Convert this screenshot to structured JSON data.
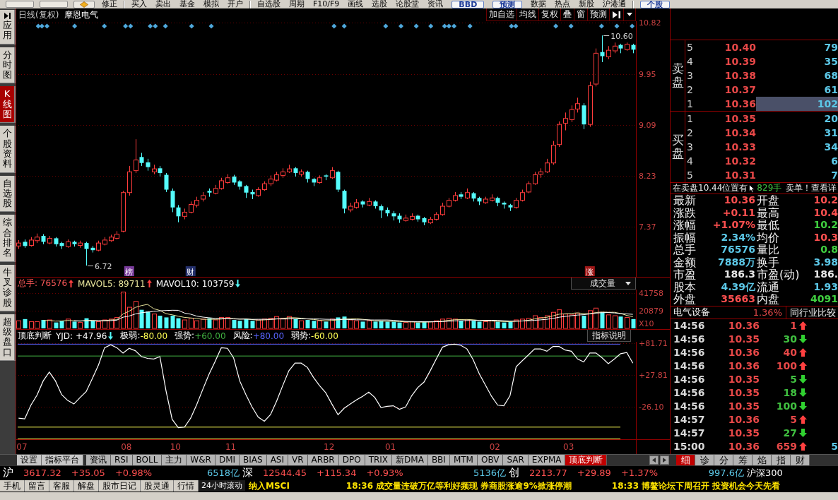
{
  "toolbar": [
    {
      "kind": "blank"
    },
    {
      "kind": "blank"
    },
    {
      "kind": "icon"
    },
    {
      "kind": "text",
      "label": "修正"
    },
    {
      "kind": "separator"
    },
    {
      "kind": "text",
      "label": "买入"
    },
    {
      "kind": "text",
      "label": "卖出"
    },
    {
      "kind": "text",
      "label": "基金"
    },
    {
      "kind": "text",
      "label": "模拟"
    },
    {
      "kind": "text",
      "label": "开户"
    },
    {
      "kind": "separator"
    },
    {
      "kind": "text",
      "label": "自选股"
    },
    {
      "kind": "text",
      "label": "周期"
    },
    {
      "kind": "text",
      "label": "F10/F9"
    },
    {
      "kind": "text",
      "label": "画线"
    },
    {
      "kind": "text",
      "label": "选股"
    },
    {
      "kind": "text",
      "label": "论股堂"
    },
    {
      "kind": "text",
      "label": "资讯"
    },
    {
      "kind": "button",
      "label": "BBD"
    },
    {
      "kind": "button",
      "label": "预测"
    },
    {
      "kind": "text",
      "label": "数据"
    },
    {
      "kind": "text",
      "label": "热点"
    },
    {
      "kind": "text",
      "label": "新股"
    },
    {
      "kind": "text",
      "label": "沪港通"
    },
    {
      "kind": "separator"
    },
    {
      "kind": "button",
      "label": "个股"
    }
  ],
  "sidebar": [
    {
      "label": "应用",
      "kind": "app",
      "selected": false
    },
    {
      "label": "分时图",
      "kind": "tab",
      "selected": false
    },
    {
      "label": "K线图",
      "kind": "tab",
      "selected": true
    },
    {
      "label": "个股资料",
      "kind": "tab",
      "selected": false
    },
    {
      "label": "自选股",
      "kind": "tab",
      "selected": false
    },
    {
      "label": "综合排名",
      "kind": "tab",
      "selected": false
    },
    {
      "label": "牛叉诊股",
      "kind": "tab",
      "selected": false
    },
    {
      "label": "超级盘口",
      "kind": "tab",
      "selected": false
    }
  ],
  "chart": {
    "period": "日线(复权)",
    "stock": "摩恩电气",
    "buttons": [
      "加自选",
      "均线",
      "复权",
      "叠",
      "窗",
      "预测"
    ],
    "price": {
      "chart_data": {
        "type": "candlestick",
        "ohlc": [
          [
            7.05,
            7.15,
            7.0,
            7.1
          ],
          [
            7.12,
            7.16,
            7.02,
            7.05
          ],
          [
            7.06,
            7.2,
            7.04,
            7.15
          ],
          [
            7.14,
            7.26,
            7.1,
            7.2
          ],
          [
            7.22,
            7.25,
            7.08,
            7.12
          ],
          [
            7.1,
            7.22,
            7.08,
            7.18
          ],
          [
            7.18,
            7.2,
            7.04,
            7.08
          ],
          [
            7.1,
            7.12,
            7.0,
            7.05
          ],
          [
            7.04,
            7.16,
            7.02,
            7.12
          ],
          [
            7.12,
            7.14,
            7.04,
            7.08
          ],
          [
            7.06,
            7.14,
            7.02,
            7.1
          ],
          [
            7.1,
            7.12,
            6.72,
            7.0
          ],
          [
            7.02,
            7.05,
            6.94,
            6.98
          ],
          [
            6.98,
            7.14,
            6.96,
            7.1
          ],
          [
            7.08,
            7.2,
            7.06,
            7.15
          ],
          [
            7.14,
            7.24,
            7.12,
            7.2
          ],
          [
            7.18,
            7.3,
            7.16,
            7.25
          ],
          [
            7.3,
            7.98,
            7.28,
            7.95
          ],
          [
            7.95,
            8.4,
            7.9,
            8.3
          ],
          [
            8.32,
            8.85,
            8.28,
            8.5
          ],
          [
            8.55,
            8.62,
            8.4,
            8.45
          ],
          [
            8.46,
            8.52,
            8.32,
            8.38
          ],
          [
            8.3,
            8.42,
            8.26,
            8.35
          ],
          [
            8.36,
            8.4,
            8.22,
            8.28
          ],
          [
            8.25,
            8.28,
            7.96,
            8.0
          ],
          [
            7.98,
            8.02,
            7.62,
            7.7
          ],
          [
            7.7,
            7.74,
            7.45,
            7.55
          ],
          [
            7.55,
            7.68,
            7.5,
            7.62
          ],
          [
            7.62,
            7.8,
            7.6,
            7.75
          ],
          [
            7.74,
            7.88,
            7.7,
            7.82
          ],
          [
            7.84,
            7.96,
            7.8,
            7.9
          ],
          [
            7.98,
            8.02,
            7.88,
            7.95
          ],
          [
            7.94,
            8.08,
            7.92,
            8.02
          ],
          [
            8.02,
            8.2,
            8.0,
            8.15
          ],
          [
            8.12,
            8.26,
            8.1,
            8.2
          ],
          [
            8.22,
            8.25,
            8.08,
            8.12
          ],
          [
            8.14,
            8.16,
            8.0,
            8.05
          ],
          [
            8.06,
            8.08,
            7.86,
            7.95
          ],
          [
            7.96,
            8.0,
            7.84,
            7.92
          ],
          [
            7.9,
            8.04,
            7.88,
            8.0
          ],
          [
            8.0,
            8.14,
            7.98,
            8.1
          ],
          [
            8.1,
            8.24,
            8.06,
            8.18
          ],
          [
            8.16,
            8.3,
            8.14,
            8.25
          ],
          [
            8.24,
            8.36,
            8.2,
            8.3
          ],
          [
            8.3,
            8.42,
            8.28,
            8.35
          ],
          [
            8.36,
            8.38,
            8.22,
            8.28
          ],
          [
            8.26,
            8.34,
            8.22,
            8.3
          ],
          [
            8.3,
            8.32,
            8.12,
            8.18
          ],
          [
            8.18,
            8.2,
            8.06,
            8.12
          ],
          [
            8.12,
            8.24,
            8.1,
            8.2
          ],
          [
            8.24,
            8.26,
            8.16,
            8.22
          ],
          [
            8.2,
            8.38,
            8.18,
            8.32
          ],
          [
            8.3,
            8.32,
            7.96,
            8.0
          ],
          [
            7.98,
            8.0,
            7.6,
            7.68
          ],
          [
            7.66,
            7.78,
            7.62,
            7.72
          ],
          [
            7.7,
            7.84,
            7.68,
            7.78
          ],
          [
            7.8,
            7.82,
            7.7,
            7.75
          ],
          [
            7.74,
            7.86,
            7.72,
            7.8
          ],
          [
            7.8,
            7.82,
            7.68,
            7.72
          ],
          [
            7.72,
            7.75,
            7.52,
            7.65
          ],
          [
            7.66,
            7.7,
            7.55,
            7.6
          ],
          [
            7.6,
            7.64,
            7.48,
            7.55
          ],
          [
            7.56,
            7.6,
            7.44,
            7.5
          ],
          [
            7.48,
            7.58,
            7.46,
            7.52
          ],
          [
            7.5,
            7.6,
            7.48,
            7.55
          ],
          [
            7.56,
            7.58,
            7.46,
            7.5
          ],
          [
            7.52,
            7.54,
            7.4,
            7.45
          ],
          [
            7.44,
            7.54,
            7.42,
            7.5
          ],
          [
            7.5,
            7.62,
            7.48,
            7.58
          ],
          [
            7.58,
            7.78,
            7.56,
            7.72
          ],
          [
            7.72,
            7.86,
            7.7,
            7.82
          ],
          [
            7.82,
            7.96,
            7.8,
            7.9
          ],
          [
            7.92,
            7.96,
            7.84,
            7.88
          ],
          [
            7.86,
            8.02,
            7.84,
            7.95
          ],
          [
            7.94,
            7.96,
            7.8,
            7.85
          ],
          [
            7.86,
            7.88,
            7.74,
            7.8
          ],
          [
            7.78,
            7.88,
            7.76,
            7.84
          ],
          [
            7.82,
            7.92,
            7.8,
            7.86
          ],
          [
            7.86,
            7.88,
            7.72,
            7.78
          ],
          [
            7.78,
            7.8,
            7.68,
            7.75
          ],
          [
            7.74,
            7.76,
            7.64,
            7.7
          ],
          [
            7.7,
            7.86,
            7.68,
            7.82
          ],
          [
            7.82,
            8.0,
            7.8,
            7.95
          ],
          [
            7.96,
            8.14,
            7.94,
            8.1
          ],
          [
            8.1,
            8.3,
            8.08,
            8.25
          ],
          [
            8.26,
            8.36,
            8.2,
            8.3
          ],
          [
            8.3,
            8.52,
            8.28,
            8.45
          ],
          [
            8.45,
            8.82,
            8.42,
            8.75
          ],
          [
            8.76,
            9.15,
            8.72,
            9.1
          ],
          [
            9.12,
            9.3,
            9.0,
            9.2
          ],
          [
            9.18,
            9.42,
            9.14,
            9.35
          ],
          [
            9.36,
            9.55,
            9.3,
            9.45
          ],
          [
            9.42,
            9.46,
            9.02,
            9.1
          ],
          [
            9.1,
            9.82,
            9.06,
            9.75
          ],
          [
            9.78,
            10.38,
            9.74,
            10.3
          ],
          [
            10.32,
            10.6,
            10.15,
            10.25
          ],
          [
            10.24,
            10.42,
            10.2,
            10.35
          ],
          [
            10.34,
            10.48,
            10.3,
            10.42
          ],
          [
            10.44,
            10.46,
            10.3,
            10.38
          ],
          [
            10.36,
            10.48,
            10.34,
            10.45
          ],
          [
            10.44,
            10.46,
            10.3,
            10.36
          ]
        ],
        "ylim": [
          6.53,
          10.84
        ],
        "yticks": [
          10.82,
          9.95,
          9.09,
          8.23,
          7.37
        ],
        "grid": true,
        "annotations": [
          "10.60",
          "6.72"
        ]
      }
    },
    "event_tags": [
      {
        "label": "榜",
        "color": "#7a3c9c"
      },
      {
        "label": "财",
        "color": "#24306c"
      },
      {
        "label": "涨",
        "color": "#a01818"
      }
    ],
    "volume": {
      "legend": [
        {
          "text": "总手: 76576",
          "rising": true,
          "color": "#ff5a5a"
        },
        {
          "text": "MAVOL5: 89711",
          "rising": true,
          "color": "#e8e49c"
        },
        {
          "text": "MAVOL10: 103759",
          "rising": false,
          "color": "#ffffff"
        }
      ],
      "selector": "成交量",
      "chart_data": {
        "type": "bar",
        "series": [
          {
            "values": [
              9000,
              11000,
              8000,
              8000,
              10000,
              10000,
              7000,
              9000,
              11000,
              8000,
              7000,
              12000,
              9000,
              8000,
              10000,
              11000,
              13000,
              43000,
              25000,
              32000,
              22000,
              20000,
              17000,
              15000,
              13000,
              15000,
              12000,
              10000,
              12000,
              9000,
              11000,
              12000,
              10000,
              13000,
              13000,
              10000,
              9000,
              11000,
              9000,
              10000,
              11000,
              12000,
              14000,
              12000,
              14000,
              11000,
              9000,
              10000,
              9000,
              9000,
              8000,
              11000,
              13000,
              14000,
              10000,
              9000,
              8000,
              9000,
              8000,
              9000,
              8000,
              8000,
              7000,
              7000,
              8000,
              7000,
              8000,
              8000,
              9000,
              11000,
              12000,
              11000,
              9000,
              10000,
              9000,
              8000,
              8000,
              9000,
              8000,
              7000,
              8000,
              10000,
              11000,
              12000,
              15000,
              13000,
              15000,
              19000,
              22000,
              17000,
              16000,
              18000,
              15000,
              21000,
              24000,
              19000,
              16000,
              15000,
              14000,
              13000,
              11000
            ],
            "colors": [
              "#ff3c3c",
              "#54fcfc",
              "#ff3c3c",
              "#ff3c3c",
              "#54fcfc",
              "#ff3c3c",
              "#54fcfc",
              "#54fcfc",
              "#ff3c3c",
              "#54fcfc",
              "#ff3c3c",
              "#54fcfc",
              "#54fcfc",
              "#ff3c3c",
              "#ff3c3c",
              "#ff3c3c",
              "#ff3c3c",
              "#ff3c3c",
              "#ff3c3c",
              "#ff3c3c",
              "#54fcfc",
              "#54fcfc",
              "#ff3c3c",
              "#54fcfc",
              "#54fcfc",
              "#54fcfc",
              "#54fcfc",
              "#ff3c3c",
              "#ff3c3c",
              "#ff3c3c",
              "#ff3c3c",
              "#54fcfc",
              "#ff3c3c",
              "#ff3c3c",
              "#ff3c3c",
              "#54fcfc",
              "#54fcfc",
              "#54fcfc",
              "#54fcfc",
              "#ff3c3c",
              "#ff3c3c",
              "#ff3c3c",
              "#ff3c3c",
              "#ff3c3c",
              "#ff3c3c",
              "#54fcfc",
              "#ff3c3c",
              "#54fcfc",
              "#54fcfc",
              "#ff3c3c",
              "#54fcfc",
              "#ff3c3c",
              "#54fcfc",
              "#54fcfc",
              "#ff3c3c",
              "#ff3c3c",
              "#54fcfc",
              "#ff3c3c",
              "#54fcfc",
              "#54fcfc",
              "#54fcfc",
              "#54fcfc",
              "#54fcfc",
              "#ff3c3c",
              "#ff3c3c",
              "#54fcfc",
              "#54fcfc",
              "#ff3c3c",
              "#ff3c3c",
              "#ff3c3c",
              "#ff3c3c",
              "#ff3c3c",
              "#54fcfc",
              "#ff3c3c",
              "#54fcfc",
              "#54fcfc",
              "#ff3c3c",
              "#ff3c3c",
              "#54fcfc",
              "#54fcfc",
              "#54fcfc",
              "#ff3c3c",
              "#ff3c3c",
              "#ff3c3c",
              "#ff3c3c",
              "#ff3c3c",
              "#ff3c3c",
              "#ff3c3c",
              "#ff3c3c",
              "#ff3c3c",
              "#ff3c3c",
              "#ff3c3c",
              "#54fcfc",
              "#ff3c3c",
              "#ff3c3c",
              "#54fcfc",
              "#ff3c3c",
              "#ff3c3c",
              "#54fcfc",
              "#ff3c3c",
              "#54fcfc"
            ]
          },
          {
            "type": "line",
            "color": "#e8e49c",
            "values": [
              null,
              null,
              null,
              null,
              9200,
              9400,
              8600,
              8800,
              9400,
              9000,
              8400,
              9400,
              9400,
              8800,
              9200,
              10000,
              10200,
              17000,
              20400,
              24800,
              27000,
              28400,
              23200,
              21200,
              17400,
              16000,
              14400,
              13000,
              12400,
              11600,
              10800,
              10800,
              10800,
              11000,
              11800,
              11600,
              11000,
              11200,
              10400,
              9800,
              10000,
              10600,
              11200,
              11800,
              12600,
              12600,
              12000,
              11200,
              10600,
              9600,
              9000,
              9400,
              10000,
              11000,
              11200,
              11400,
              10800,
              10000,
              8800,
              8600,
              8400,
              8400,
              8000,
              7800,
              7600,
              7400,
              7400,
              7600,
              8000,
              8600,
              9600,
              10200,
              10400,
              10600,
              10200,
              9400,
              8800,
              8800,
              8400,
              8000,
              8000,
              8400,
              8800,
              9600,
              11200,
              12200,
              13200,
              14800,
              16800,
              17200,
              17800,
              18400,
              17600,
              17400,
              18800,
              19400,
              19000,
              19000,
              17600,
              15400,
              13800
            ]
          },
          {
            "type": "line",
            "color": "#ffffff",
            "values": [
              null,
              null,
              null,
              null,
              null,
              null,
              null,
              null,
              null,
              9100,
              8900,
              9000,
              9100,
              9100,
              9100,
              9200,
              9800,
              13200,
              14600,
              17000,
              18500,
              19300,
              20100,
              20800,
              21100,
              21500,
              21400,
              18100,
              16800,
              14500,
              13400,
              12600,
              11900,
              11700,
              11700,
              11200,
              10900,
              11000,
              10700,
              10800,
              10800,
              10800,
              11200,
              11100,
              11200,
              11300,
              11300,
              11200,
              11200,
              11100,
              10800,
              10700,
              10600,
              10800,
              10400,
              10200,
              10100,
              10000,
              9900,
              9900,
              9900,
              9600,
              9000,
              8300,
              8100,
              7900,
              7900,
              7800,
              7900,
              8100,
              8500,
              8800,
              9000,
              9300,
              9400,
              9500,
              9500,
              9600,
              9500,
              9100,
              8700,
              8600,
              8800,
              9000,
              9600,
              10100,
              10800,
              11800,
              13200,
              14200,
              15000,
              15800,
              16200,
              17100,
              18000,
              18600,
              18700,
              18300,
              17500,
              17100,
              16600
            ]
          }
        ],
        "ylim": [
          0,
          45934
        ],
        "yticks": [
          41758,
          20879
        ],
        "ylabel": "X10",
        "grid": true
      }
    },
    "indicator": {
      "name": "顶底判断",
      "reading": "YJD: +47.96",
      "rising": false,
      "levels": [
        {
          "label": "极弱:",
          "value": "-80.00",
          "color": "#ffff54"
        },
        {
          "label": "强势:",
          "value": "+60.00",
          "color": "#40b040"
        },
        {
          "label": "风险:",
          "value": "+80.00",
          "color": "#5a64ff"
        },
        {
          "label": "弱势:",
          "value": "-60.00",
          "color": "#ffff54"
        }
      ],
      "help_button": "指标说明",
      "chart_data": {
        "type": "line",
        "values": [
          -45,
          -46,
          -23,
          -6,
          18,
          33,
          18,
          -5,
          -15,
          -21,
          -10,
          0,
          22,
          45,
          74,
          79,
          74,
          65,
          73,
          69,
          59,
          56,
          55,
          59,
          1,
          -47,
          -61,
          -60,
          -45,
          -22,
          4,
          29,
          51,
          74,
          73,
          57,
          18,
          -5,
          -26,
          -43,
          -50,
          -39,
          -16,
          10,
          35,
          48,
          48,
          41,
          24,
          10,
          -2,
          -21,
          -39,
          -28,
          -21,
          -14,
          -8,
          -1,
          -10,
          -27,
          -25,
          -24,
          -30,
          -26,
          -7,
          7,
          16,
          35,
          55,
          75,
          79,
          80,
          78,
          72,
          54,
          30,
          11,
          -8,
          -23,
          -24,
          -7,
          42,
          52,
          62,
          72,
          72,
          68,
          76,
          76,
          70,
          68,
          55,
          50,
          65,
          65,
          57,
          47,
          55,
          64,
          66,
          48
        ],
        "ylim": [
          -80.5,
          84
        ],
        "yticks": [
          {
            "value": 81.71,
            "label": "+81.71"
          },
          {
            "value": 27.81,
            "label": "+27.81"
          },
          {
            "value": -26.1,
            "label": "-26.10"
          }
        ],
        "grid": true,
        "ref_lines": [
          {
            "axis": "y",
            "value": -80
          },
          {
            "axis": "y",
            "value": 60
          },
          {
            "axis": "y",
            "value": 80
          },
          {
            "axis": "y",
            "value": -60
          }
        ]
      }
    },
    "months": [
      "07",
      "08",
      "10",
      "11",
      "12",
      "01",
      "02",
      "03"
    ]
  },
  "order_book": {
    "sell_label": "卖盘",
    "buy_label": "买盘",
    "sell": [
      {
        "level": "5",
        "price": "10.40",
        "volume": "79",
        "selected": false
      },
      {
        "level": "4",
        "price": "10.39",
        "volume": "35",
        "selected": false
      },
      {
        "level": "3",
        "price": "10.38",
        "volume": "68",
        "selected": false
      },
      {
        "level": "2",
        "price": "10.37",
        "volume": "61",
        "selected": false
      },
      {
        "level": "1",
        "price": "10.36",
        "volume": "102",
        "selected": true
      }
    ],
    "buy": [
      {
        "level": "1",
        "price": "10.35",
        "volume": "20",
        "selected": false
      },
      {
        "level": "2",
        "price": "10.34",
        "volume": "31",
        "selected": false
      },
      {
        "level": "3",
        "price": "10.33",
        "volume": "34",
        "selected": false
      },
      {
        "level": "4",
        "price": "10.32",
        "volume": "6",
        "selected": false
      },
      {
        "level": "5",
        "price": "10.31",
        "volume": "7",
        "selected": false
      }
    ]
  },
  "alert": {
    "before": "在卖盘10.44位置有",
    "amount": "829手",
    "after": "卖单！查看详"
  },
  "quote": [
    {
      "label": "最新",
      "value": "10.36",
      "color": "#ff5050"
    },
    {
      "label": "开盘",
      "value": "10.2",
      "color": "#ff5050"
    },
    {
      "label": "涨跌",
      "value": "+0.11",
      "color": "#ff5050"
    },
    {
      "label": "最高",
      "value": "10.4",
      "color": "#ff5050"
    },
    {
      "label": "涨幅",
      "value": "+1.07%",
      "color": "#ff5050"
    },
    {
      "label": "最低",
      "value": "10.2",
      "color": "#40d040"
    },
    {
      "label": "振幅",
      "value": "2.34%",
      "color": "#5cc8e8"
    },
    {
      "label": "均价",
      "value": "10.3",
      "color": "#ff5050"
    },
    {
      "label": "总手",
      "value": "76576",
      "color": "#5cc8e8"
    },
    {
      "label": "量比",
      "value": "0.8",
      "color": "#40d040"
    },
    {
      "label": "金额",
      "value": "7888万",
      "color": "#5cc8e8"
    },
    {
      "label": "换手",
      "value": "3.98",
      "color": "#5cc8e8"
    },
    {
      "label": "市盈",
      "value": "186.3",
      "color": "#e8e8e8"
    },
    {
      "label": "市盈(动)",
      "value": "186.",
      "color": "#e8e8e8"
    },
    {
      "label": "股本",
      "value": "4.39亿",
      "color": "#5cc8e8"
    },
    {
      "label": "流通",
      "value": "1.93",
      "color": "#5cc8e8"
    },
    {
      "label": "外盘",
      "value": "35663",
      "color": "#ff5050"
    },
    {
      "label": "内盘",
      "value": "4091",
      "color": "#40d040"
    }
  ],
  "industry": {
    "name": "电气设备",
    "change": "1.36%",
    "compare_button": "同行业比较"
  },
  "ticks": [
    {
      "time": "14:56",
      "price": "10.36",
      "volume": "1",
      "up": true
    },
    {
      "time": "14:56",
      "price": "10.35",
      "volume": "30",
      "up": false
    },
    {
      "time": "14:56",
      "price": "10.36",
      "volume": "40",
      "up": true
    },
    {
      "time": "14:56",
      "price": "10.36",
      "volume": "100",
      "up": true
    },
    {
      "time": "14:56",
      "price": "10.35",
      "volume": "5",
      "up": false
    },
    {
      "time": "14:56",
      "price": "10.35",
      "volume": "18",
      "up": false
    },
    {
      "time": "14:56",
      "price": "10.35",
      "volume": "100",
      "up": false
    },
    {
      "time": "14:57",
      "price": "10.36",
      "volume": "5",
      "up": true
    },
    {
      "time": "14:57",
      "price": "10.35",
      "volume": "27",
      "up": false
    },
    {
      "time": "15:00",
      "price": "10.36",
      "volume": "659",
      "up": true,
      "extra": "5"
    }
  ],
  "chart_tabs": {
    "buttons": [
      "设置",
      "指标平台"
    ],
    "tabs": [
      {
        "label": "资讯",
        "selected": false
      },
      {
        "label": "RSI",
        "selected": false
      },
      {
        "label": "BOLL",
        "selected": false
      },
      {
        "label": "主力",
        "selected": false
      },
      {
        "label": "W&R",
        "selected": false
      },
      {
        "label": "DMI",
        "selected": false
      },
      {
        "label": "BIAS",
        "selected": false
      },
      {
        "label": "ASI",
        "selected": false
      },
      {
        "label": "VR",
        "selected": false
      },
      {
        "label": "ARBR",
        "selected": false
      },
      {
        "label": "DPO",
        "selected": false
      },
      {
        "label": "TRIX",
        "selected": false
      },
      {
        "label": "新DMA",
        "selected": false
      },
      {
        "label": "BBI",
        "selected": false
      },
      {
        "label": "MTM",
        "selected": false
      },
      {
        "label": "OBV",
        "selected": false
      },
      {
        "label": "SAR",
        "selected": false
      },
      {
        "label": "EXPMA",
        "selected": false
      },
      {
        "label": "顶底判断",
        "selected": true
      }
    ]
  },
  "panel_tabs": [
    {
      "label": "细",
      "selected": true
    },
    {
      "label": "诊",
      "selected": false
    },
    {
      "label": "分",
      "selected": false
    },
    {
      "label": "筹",
      "selected": false
    },
    {
      "label": "焰",
      "selected": false
    },
    {
      "label": "指",
      "selected": false
    },
    {
      "label": "财",
      "selected": false
    }
  ],
  "indices": [
    {
      "name": "沪",
      "value": "3617.32",
      "change": "+35.05",
      "percent": "+0.98%",
      "amount": "6518亿",
      "rising": true
    },
    {
      "name": "深",
      "value": "12544.45",
      "change": "+115.34",
      "percent": "+0.93%",
      "amount": "5136亿",
      "rising": true
    },
    {
      "name": "创",
      "value": "2213.77",
      "change": "+29.89",
      "percent": "+1.37%",
      "amount": "997.6亿",
      "rising": true
    }
  ],
  "index_button": "沪深300",
  "news_bar": {
    "buttons": [
      "手机",
      "留言",
      "客服",
      "解盘",
      "股市日记",
      "股灵通",
      "行情"
    ],
    "ticker_label": "24小时滚动",
    "headlines": [
      "纳入MSCI",
      "18:36 成交量连破万亿等利好频现 券商股涨逾9%掀涨停潮",
      "18:33 博鳌论坛下周召开 投资机会今天先看"
    ]
  }
}
